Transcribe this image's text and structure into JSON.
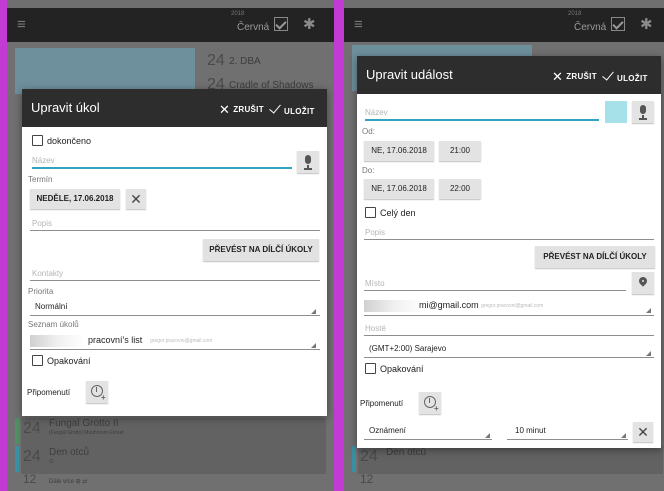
{
  "left": {
    "menu_glyph": "≡",
    "month_small": "2018",
    "month": "Červná",
    "bg_rows": [
      {
        "day": "24",
        "text": "2. DBA"
      },
      {
        "day": "24",
        "text": "Cradle of Shadows"
      }
    ],
    "bg_bottom": [
      {
        "day": "24",
        "title": "Fungal Grotto II",
        "sub": "(Fungal Grotto) Mushroom Forest"
      },
      {
        "day": "24",
        "title": "Den otců",
        "sub": "⊙"
      },
      {
        "day": "12",
        "title": "",
        "sub": "Dále více ⊞ ⇄"
      }
    ],
    "dialog": {
      "title": "Upravit úkol",
      "cancel": "ZRUŠIT",
      "save": "ULOŽIT",
      "done_label": "dokončeno",
      "name_placeholder": "Název",
      "deadline_label": "Termín",
      "deadline_value": "NEDĚLE, 17.06.2018",
      "clear_glyph": "✕",
      "description_placeholder": "Popis",
      "convert_button": "PŘEVÉST NA DÍLČÍ ÚKOLY",
      "contacts_placeholder": "Kontakty",
      "priority_label": "Priorita",
      "priority_value": "Normální",
      "list_label": "Seznam úkolů",
      "list_value": "pracovní's list",
      "list_account": "gregor.pracovni@gmail.com",
      "repeat_label": "Opakování",
      "reminders_label": "Připomenutí"
    }
  },
  "right": {
    "menu_glyph": "≡",
    "month_small": "2018",
    "month": "Červná",
    "bg_bottom": [
      {
        "day": "24",
        "title": "Den otců"
      },
      {
        "day": "12",
        "title": ""
      }
    ],
    "dialog": {
      "title": "Upravit událost",
      "cancel": "ZRUŠIT",
      "save": "ULOŽIT",
      "name_placeholder": "Název",
      "color_swatch": "#a6e1ea",
      "from_label": "Od:",
      "from_date": "NE, 17.06.2018",
      "from_time": "21:00",
      "to_label": "Do:",
      "to_date": "NE, 17.06.2018",
      "to_time": "22:00",
      "all_day_label": "Celý den",
      "description_placeholder": "Popis",
      "convert_button": "PŘEVÉST NA DÍLČÍ ÚKOLY",
      "location_placeholder": "Místo",
      "account_value": "mi@gmail.com",
      "account_sub": "gregor.pracovni@gmail.com",
      "guests_placeholder": "Hosté",
      "timezone_value": "(GMT+2:00) Sarajevo",
      "repeat_label": "Opakování",
      "reminders_label": "Připomenutí",
      "notify_type": "Oznámení",
      "notify_time": "10 minut",
      "clear_glyph": "✕"
    }
  },
  "colors": {
    "divider": "#c23bd3",
    "header": "#2d2d2d",
    "accent_line": "#30a3c3"
  }
}
